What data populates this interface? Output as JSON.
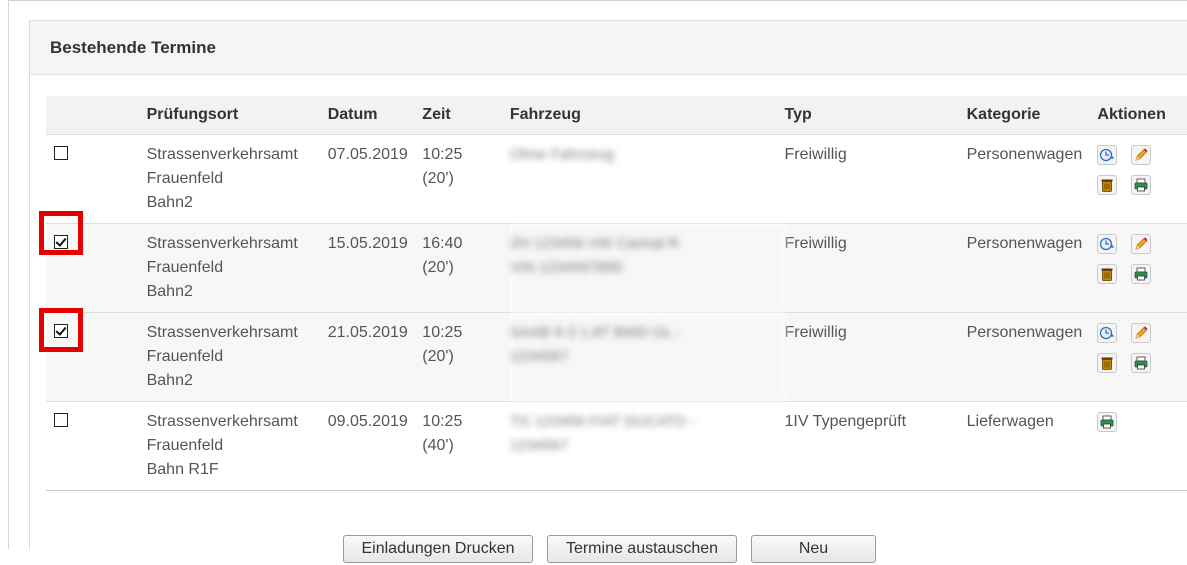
{
  "panel": {
    "title": "Bestehende Termine"
  },
  "table": {
    "headers": [
      "",
      "Prüfungsort",
      "Datum",
      "Zeit",
      "Fahrzeug",
      "Typ",
      "Kategorie",
      "Aktionen"
    ],
    "rows": [
      {
        "checked": false,
        "ort1": "Strassenverkehrsamt",
        "ort2": "Frauenfeld",
        "ort3": "Bahn2",
        "datum": "07.05.2019",
        "zeit": "10:25",
        "dauer": "(20')",
        "fahrzeug1": "Ohne Fahrzeug",
        "fahrzeug2": "",
        "typ": "Freiwillig",
        "kategorie": "Personenwagen"
      },
      {
        "checked": true,
        "ort1": "Strassenverkehrsamt",
        "ort2": "Frauenfeld",
        "ort3": "Bahn2",
        "datum": "15.05.2019",
        "zeit": "16:40",
        "dauer": "(20')",
        "fahrzeug1": "ZH 123456 VW Carinal R",
        "fahrzeug2": "VIN 1234567890",
        "typ": "Freiwillig",
        "kategorie": "Personenwagen"
      },
      {
        "checked": true,
        "ort1": "Strassenverkehrsamt",
        "ort2": "Frauenfeld",
        "ort3": "Bahn2",
        "datum": "21.05.2019",
        "zeit": "10:25",
        "dauer": "(20')",
        "fahrzeug1": "SAAB 9-3 1.8T BWD GL -",
        "fahrzeug2": "1234567",
        "typ": "Freiwillig",
        "kategorie": "Personenwagen"
      },
      {
        "checked": false,
        "ort1": "Strassenverkehrsamt",
        "ort2": "Frauenfeld",
        "ort3": "Bahn R1F",
        "datum": "09.05.2019",
        "zeit": "10:25",
        "dauer": "(40')",
        "fahrzeug1": "TG 123456 FIAT DUCATO -",
        "fahrzeug2": "1234567",
        "typ": "1IV Typengeprüft",
        "kategorie": "Lieferwagen"
      }
    ]
  },
  "buttons": {
    "print": "Einladungen Drucken",
    "swap": "Termine austauschen",
    "new": "Neu"
  },
  "icons": {
    "reschedule": "clock-arrow-icon",
    "edit": "pencil-icon",
    "delete": "trash-icon",
    "print": "printer-icon"
  },
  "colors": {
    "highlight": "#e60000",
    "header_bg": "#f2f2f2"
  }
}
